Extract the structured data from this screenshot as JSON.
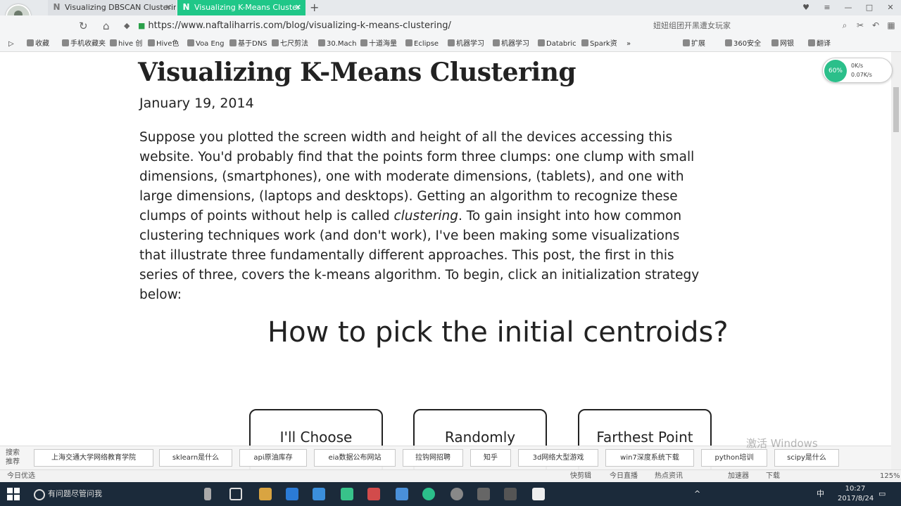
{
  "browser": {
    "tabs": [
      {
        "label": "Visualizing DBSCAN Clusterin",
        "icon": "N"
      },
      {
        "label": "Visualizing K-Means Cluster",
        "icon": "N"
      }
    ],
    "new_tab_glyph": "+",
    "url": "https://www.naftaliharris.com/blog/visualizing-k-means-clustering/",
    "search_hint": "妞妞组团开黑遭女玩家",
    "bookmarks": [
      "收藏",
      "手机收藏夹",
      "hive 创",
      "Hive色",
      "Voa Eng",
      "基于DNS",
      "七尺剪法",
      "30.Mach",
      "十道海量",
      "Eclipse",
      "机器学习",
      "机器学习",
      "Databric",
      "Spark资",
      "»"
    ],
    "right_bookmarks": [
      "扩展",
      "360安全",
      "网银",
      "翻译"
    ]
  },
  "article": {
    "title": "Visualizing K-Means Clustering",
    "date": "January 19, 2014",
    "para_before_em": "Suppose you plotted the screen width and height of all the devices accessing this website. You'd probably find that the points form three clumps: one clump with small dimensions, (smartphones), one with moderate dimensions, (tablets), and one with large dimensions, (laptops and desktops). Getting an algorithm to recognize these clumps of points without help is called ",
    "para_em": "clustering",
    "para_after_em": ". To gain insight into how common clustering techniques work (and don't work), I've been making some visualizations that illustrate three fundamentally different approaches. This post, the first in this series of three, covers the k-means algorithm. To begin, click an initialization strategy below:",
    "question": "How to pick the initial centroids?",
    "choices": [
      "I'll Choose",
      "Randomly",
      "Farthest Point"
    ]
  },
  "net_widget": {
    "badge": "60%",
    "up": "0K/s",
    "down": "0.07K/s"
  },
  "hot_search": {
    "label_line1": "搜索",
    "label_line2": "推荐",
    "items": [
      "上海交通大学网络教育学院",
      "sklearn是什么",
      "api原油库存",
      "eia数据公布网站",
      "拉钩网招聘",
      "知乎",
      "3d网络大型游戏",
      "win7深度系统下载",
      "python培训",
      "scipy是什么"
    ]
  },
  "watermark": "激活 Windows",
  "statusbar": {
    "left": "今日优选",
    "items": [
      "快剪辑",
      "今日直播",
      "热点资讯",
      "加速器",
      "下载",
      "125%"
    ]
  },
  "taskbar": {
    "search_placeholder": "有问题尽管问我",
    "time": "10:27",
    "date": "2017/8/24",
    "ime": "中"
  }
}
